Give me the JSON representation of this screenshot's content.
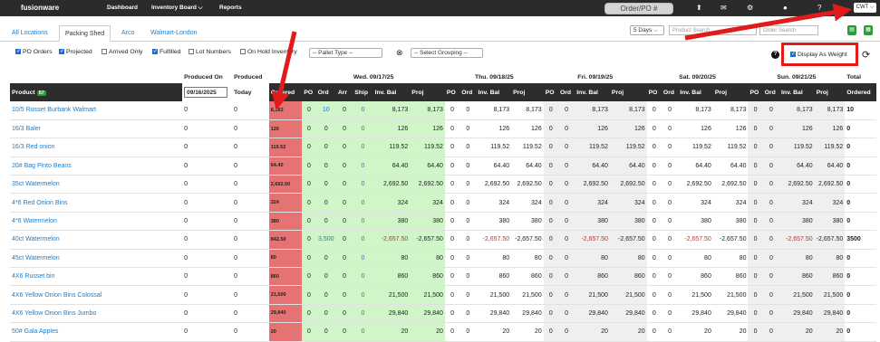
{
  "topbar": {
    "logo": "fusionware",
    "nav": [
      "Dashboard",
      "Inventory Board ⌵",
      "Reports"
    ],
    "order_button": "Order/PO #",
    "unit": "CWT ⌵"
  },
  "tabs": [
    "All Locations",
    "Packing Shed",
    "Arco",
    "Walmart-London"
  ],
  "controls": {
    "days": "5 Days ⌵",
    "product_search": "Product Search",
    "order_search": "Order Search",
    "pallet_type": "-- Pallet Type --",
    "grouping": "-- Select Grouping --"
  },
  "filters": [
    {
      "label": "PO Orders",
      "checked": true
    },
    {
      "label": "Projected",
      "checked": true
    },
    {
      "label": "Arrived Only",
      "checked": false
    },
    {
      "label": "Fulfilled",
      "checked": true
    },
    {
      "label": "Lot Numbers",
      "checked": false
    },
    {
      "label": "On Hold Inventory",
      "checked": false
    }
  ],
  "display_as_weight": "Display As Weight",
  "header": {
    "produced_on": "Produced On",
    "produced": "Produced",
    "date_value": "09/16/2025",
    "today": "Today",
    "product": "Product",
    "product_count": "57",
    "ordered_col": "Ordered",
    "days": [
      "Wed. 09/17/25",
      "Thu. 09/18/25",
      "Fri. 09/19/25",
      "Sat. 09/20/25",
      "Sun. 09/21/25"
    ],
    "sub": [
      "PO",
      "Ord",
      "Arr",
      "Ship",
      "Inv. Bal",
      "Proj"
    ],
    "sub_short": [
      "PO",
      "Ord",
      "Inv. Bal",
      "Proj"
    ],
    "total": "Total",
    "total_sub": "Ordered"
  },
  "rows": [
    {
      "product": "10/5 Russet Burbank Walmart",
      "p1": "0",
      "p2": "0",
      "ord": "8,183",
      "wed": [
        "0",
        "10",
        "0",
        "0",
        "8,173",
        "8,173"
      ],
      "bal": "8,173",
      "proj": "8,173",
      "total": "10"
    },
    {
      "product": "16/3 Baler",
      "p1": "0",
      "p2": "0",
      "ord": "126",
      "wed": [
        "0",
        "0",
        "0",
        "0",
        "126",
        "126"
      ],
      "bal": "126",
      "proj": "126",
      "total": "0"
    },
    {
      "product": "16/3 Red onion",
      "p1": "0",
      "p2": "0",
      "ord": "119.52",
      "wed": [
        "0",
        "0",
        "0",
        "0",
        "119.52",
        "119.52"
      ],
      "bal": "119.52",
      "proj": "119.52",
      "total": "0"
    },
    {
      "product": "20# Bag Pinto Beans",
      "p1": "0",
      "p2": "0",
      "ord": "64.40",
      "wed": [
        "0",
        "0",
        "0",
        "0",
        "64.40",
        "64.40"
      ],
      "bal": "64.40",
      "proj": "64.40",
      "total": "0"
    },
    {
      "product": "35ct Watermelon",
      "p1": "0",
      "p2": "0",
      "ord": "2,692.50",
      "wed": [
        "0",
        "0",
        "0",
        "0",
        "2,692.50",
        "2,692.50"
      ],
      "bal": "2,692.50",
      "proj": "2,692.50",
      "total": "0"
    },
    {
      "product": "4*6 Red Onion Bins",
      "p1": "0",
      "p2": "0",
      "ord": "324",
      "wed": [
        "0",
        "0",
        "0",
        "0",
        "324",
        "324"
      ],
      "bal": "324",
      "proj": "324",
      "total": "0"
    },
    {
      "product": "4*6 Watermelon",
      "p1": "0",
      "p2": "0",
      "ord": "380",
      "wed": [
        "0",
        "0",
        "0",
        "0",
        "380",
        "380"
      ],
      "bal": "380",
      "proj": "380",
      "total": "0"
    },
    {
      "product": "40ct Watermelon",
      "p1": "0",
      "p2": "0",
      "ord": "842.50",
      "wed": [
        "0",
        "3,500",
        "0",
        "0",
        "-2,657.50",
        "-2,657.50"
      ],
      "bal": "-2,657.50",
      "proj": "-2,657.50",
      "total": "3500",
      "neg": true
    },
    {
      "product": "45ct Watermelon",
      "p1": "0",
      "p2": "0",
      "ord": "80",
      "wed": [
        "0",
        "0",
        "0",
        "0",
        "80",
        "80"
      ],
      "bal": "80",
      "proj": "80",
      "total": "0"
    },
    {
      "product": "4X6 Russet bin",
      "p1": "0",
      "p2": "0",
      "ord": "860",
      "wed": [
        "0",
        "0",
        "0",
        "0",
        "860",
        "860"
      ],
      "bal": "860",
      "proj": "860",
      "total": "0"
    },
    {
      "product": "4X6 Yellow Onion Bins Colossal",
      "p1": "0",
      "p2": "0",
      "ord": "21,500",
      "wed": [
        "0",
        "0",
        "0",
        "0",
        "21,500",
        "21,500"
      ],
      "bal": "21,500",
      "proj": "21,500",
      "total": "0"
    },
    {
      "product": "4X6 Yellow Onion Bins Jumbo",
      "p1": "0",
      "p2": "0",
      "ord": "29,840",
      "wed": [
        "0",
        "0",
        "0",
        "0",
        "29,840",
        "29,840"
      ],
      "bal": "29,840",
      "proj": "29,840",
      "total": "0"
    },
    {
      "product": "50# Gala Apples",
      "p1": "0",
      "p2": "0",
      "ord": "20",
      "wed": [
        "0",
        "0",
        "0",
        "0",
        "20",
        "20"
      ],
      "bal": "20",
      "proj": "20",
      "total": "0"
    }
  ]
}
